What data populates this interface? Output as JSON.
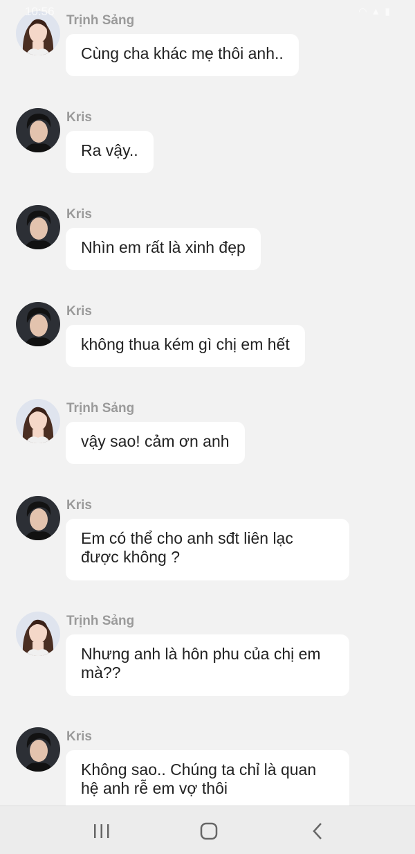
{
  "status_bar": {
    "time": "10:56",
    "icons": [
      "wifi-icon",
      "signal-icon",
      "battery-icon"
    ]
  },
  "messages": [
    {
      "sender": "Trịnh Sảng",
      "avatar": "trinh-sang-avatar",
      "text": "Cùng cha khác mẹ thôi anh.."
    },
    {
      "sender": "Kris",
      "avatar": "kris-avatar",
      "text": "Ra vậy.."
    },
    {
      "sender": "Kris",
      "avatar": "kris-avatar",
      "text": "Nhìn em rất là xinh đẹp"
    },
    {
      "sender": "Kris",
      "avatar": "kris-avatar",
      "text": "không thua kém gì chị em hết"
    },
    {
      "sender": "Trịnh Sảng",
      "avatar": "trinh-sang-avatar",
      "text": "vậy sao! cảm ơn anh"
    },
    {
      "sender": "Kris",
      "avatar": "kris-avatar",
      "text": "Em có thể cho anh sđt liên lạc được không ?"
    },
    {
      "sender": "Trịnh Sảng",
      "avatar": "trinh-sang-avatar",
      "text": "Nhưng anh là hôn phu của chị em mà??"
    },
    {
      "sender": "Kris",
      "avatar": "kris-avatar",
      "text": "Không sao.. Chúng ta chỉ là quan hệ anh rễ em vợ thôi"
    }
  ],
  "navbar": {
    "recents": "recents-icon",
    "home": "home-icon",
    "back": "back-icon"
  },
  "colors": {
    "background": "#f2f2f2",
    "bubble": "#ffffff",
    "sender_name": "#9a9a9a",
    "text": "#222222"
  }
}
